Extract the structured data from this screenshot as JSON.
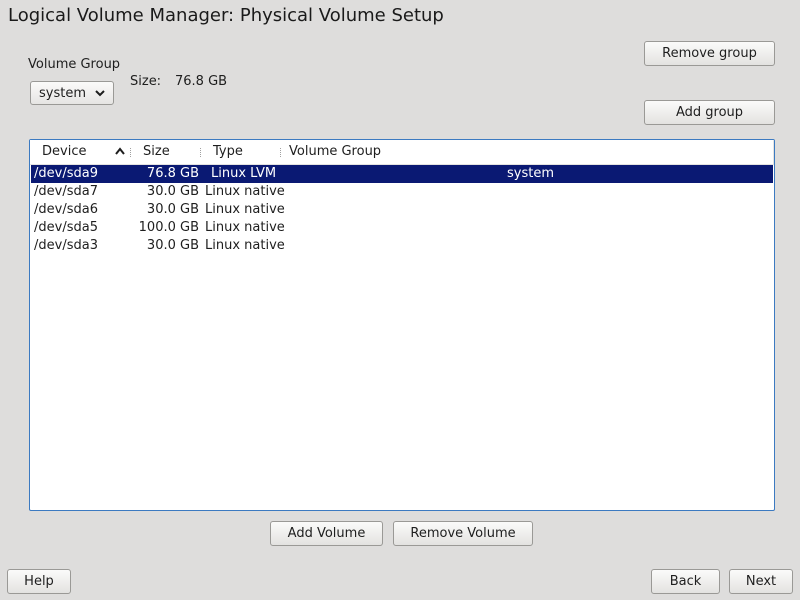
{
  "window": {
    "title": "Logical Volume Manager: Physical Volume Setup"
  },
  "volume_group": {
    "label": "Volume Group",
    "selected": "system",
    "size_label": "Size:",
    "size_value": "76.8 GB"
  },
  "buttons": {
    "remove_group": "Remove group",
    "add_group": "Add group",
    "add_volume": "Add Volume",
    "remove_volume": "Remove Volume",
    "help": "Help",
    "back": "Back",
    "next": "Next"
  },
  "table": {
    "columns": [
      "Device",
      "Size",
      "Type",
      "Volume Group"
    ],
    "rows": [
      {
        "device": "/dev/sda9",
        "size": "76.8 GB",
        "type": "Linux LVM",
        "vg": "system",
        "selected": true
      },
      {
        "device": "/dev/sda7",
        "size": "30.0 GB",
        "type": "Linux native",
        "vg": "",
        "selected": false
      },
      {
        "device": "/dev/sda6",
        "size": "30.0 GB",
        "type": "Linux native",
        "vg": "",
        "selected": false
      },
      {
        "device": "/dev/sda5",
        "size": "100.0 GB",
        "type": "Linux native",
        "vg": "",
        "selected": false
      },
      {
        "device": "/dev/sda3",
        "size": "30.0 GB",
        "type": "Linux native",
        "vg": "",
        "selected": false
      }
    ]
  },
  "colors": {
    "background": "#dedddc",
    "selection": "#0a1973",
    "focus_border": "#3c7ac1"
  }
}
